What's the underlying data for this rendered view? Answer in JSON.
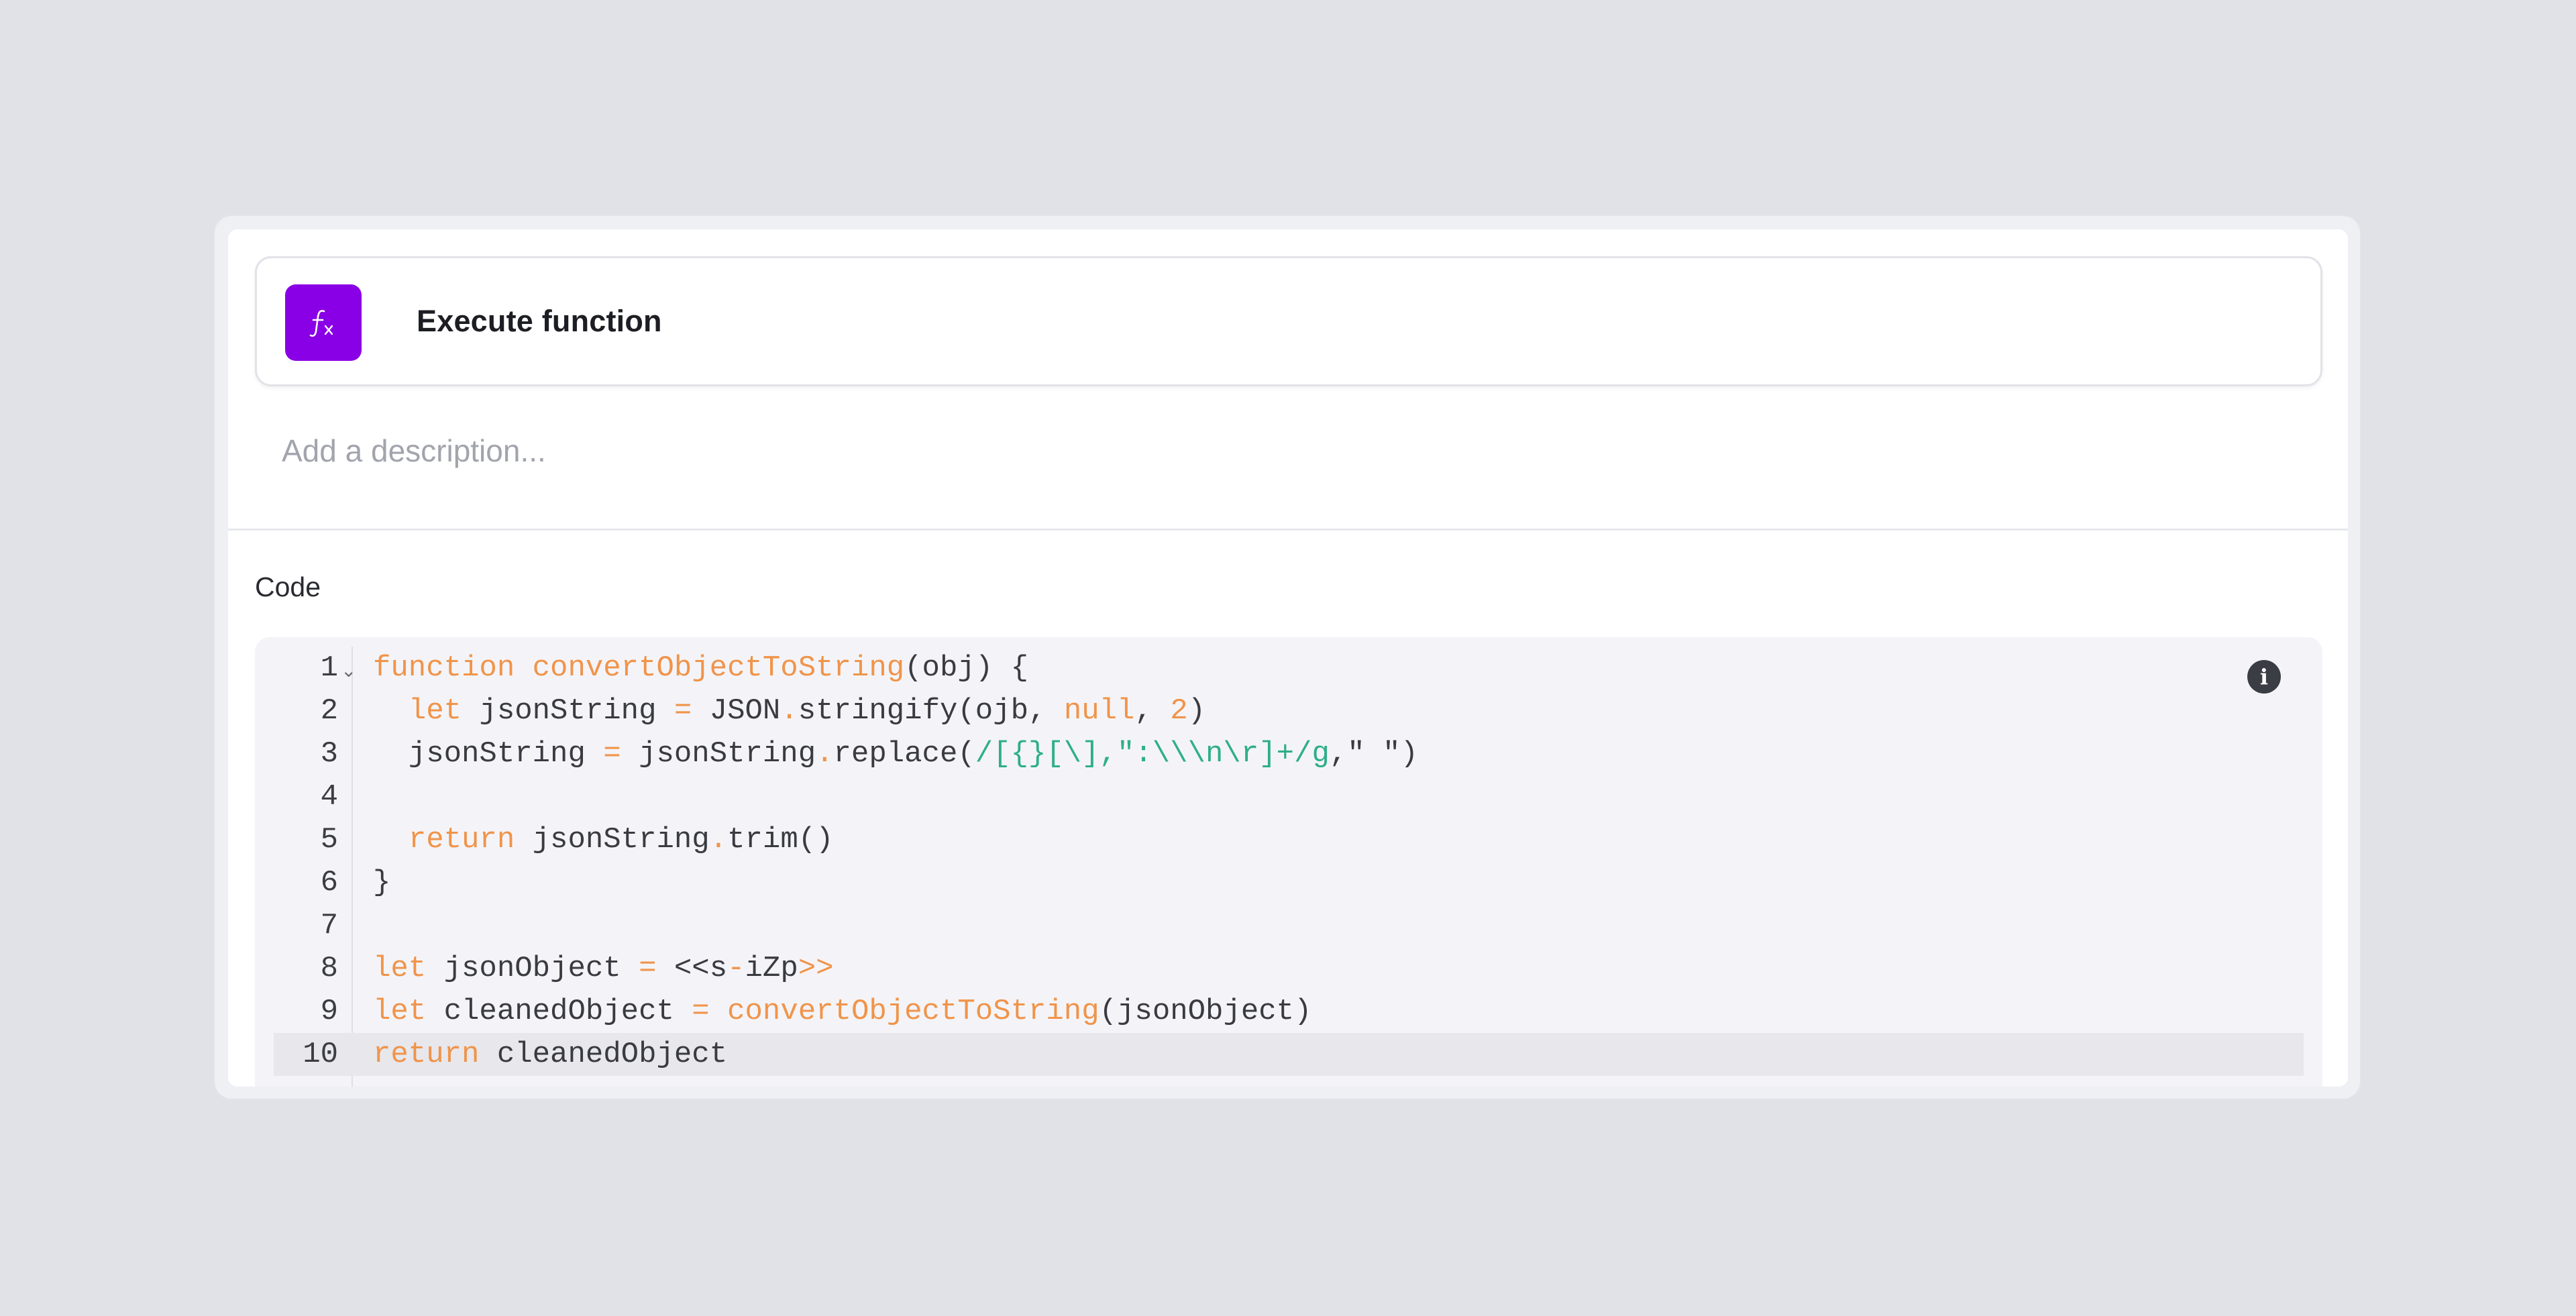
{
  "accent_color": "#8a00e6",
  "step": {
    "icon": "function-icon",
    "title": "Execute function"
  },
  "description": {
    "value": "",
    "placeholder": "Add a description..."
  },
  "code_section": {
    "label": "Code",
    "info_icon": "info-icon",
    "info_glyph": "i",
    "active_line": 10,
    "lines": [
      {
        "number": "1",
        "foldable": true,
        "tokens": [
          {
            "t": "function",
            "c": "kw"
          },
          {
            "t": " ",
            "c": ""
          },
          {
            "t": "convertObjectToString",
            "c": "fn"
          },
          {
            "t": "(obj) {",
            "c": ""
          }
        ]
      },
      {
        "number": "2",
        "tokens": [
          {
            "t": "  ",
            "c": ""
          },
          {
            "t": "let",
            "c": "kw"
          },
          {
            "t": " jsonString ",
            "c": ""
          },
          {
            "t": "=",
            "c": "op"
          },
          {
            "t": " JSON",
            "c": ""
          },
          {
            "t": ".",
            "c": "op"
          },
          {
            "t": "stringify(ojb, ",
            "c": ""
          },
          {
            "t": "null",
            "c": "kw"
          },
          {
            "t": ", ",
            "c": ""
          },
          {
            "t": "2",
            "c": "num"
          },
          {
            "t": ")",
            "c": ""
          }
        ]
      },
      {
        "number": "3",
        "tokens": [
          {
            "t": "  jsonString ",
            "c": ""
          },
          {
            "t": "=",
            "c": "op"
          },
          {
            "t": " jsonString",
            "c": ""
          },
          {
            "t": ".",
            "c": "op"
          },
          {
            "t": "replace(",
            "c": ""
          },
          {
            "t": "/[{}[\\],\":\\\\\\n\\r]+/g",
            "c": "rx"
          },
          {
            "t": ",\" \")",
            "c": ""
          }
        ]
      },
      {
        "number": "4",
        "tokens": []
      },
      {
        "number": "5",
        "tokens": [
          {
            "t": "  ",
            "c": ""
          },
          {
            "t": "return",
            "c": "kw"
          },
          {
            "t": " jsonString",
            "c": ""
          },
          {
            "t": ".",
            "c": "op"
          },
          {
            "t": "trim()",
            "c": ""
          }
        ]
      },
      {
        "number": "6",
        "tokens": [
          {
            "t": "}",
            "c": ""
          }
        ]
      },
      {
        "number": "7",
        "tokens": []
      },
      {
        "number": "8",
        "tokens": [
          {
            "t": "let",
            "c": "kw"
          },
          {
            "t": " jsonObject ",
            "c": ""
          },
          {
            "t": "=",
            "c": "op"
          },
          {
            "t": " <<s",
            "c": ""
          },
          {
            "t": "-",
            "c": "op"
          },
          {
            "t": "iZp",
            "c": ""
          },
          {
            "t": ">>",
            "c": "op"
          }
        ]
      },
      {
        "number": "9",
        "tokens": [
          {
            "t": "let",
            "c": "kw"
          },
          {
            "t": " cleanedObject ",
            "c": ""
          },
          {
            "t": "=",
            "c": "op"
          },
          {
            "t": " ",
            "c": ""
          },
          {
            "t": "convertObjectToString",
            "c": "fn"
          },
          {
            "t": "(jsonObject)",
            "c": ""
          }
        ]
      },
      {
        "number": "10",
        "tokens": [
          {
            "t": "return",
            "c": "kw"
          },
          {
            "t": " cleanedObject",
            "c": ""
          }
        ]
      }
    ]
  }
}
